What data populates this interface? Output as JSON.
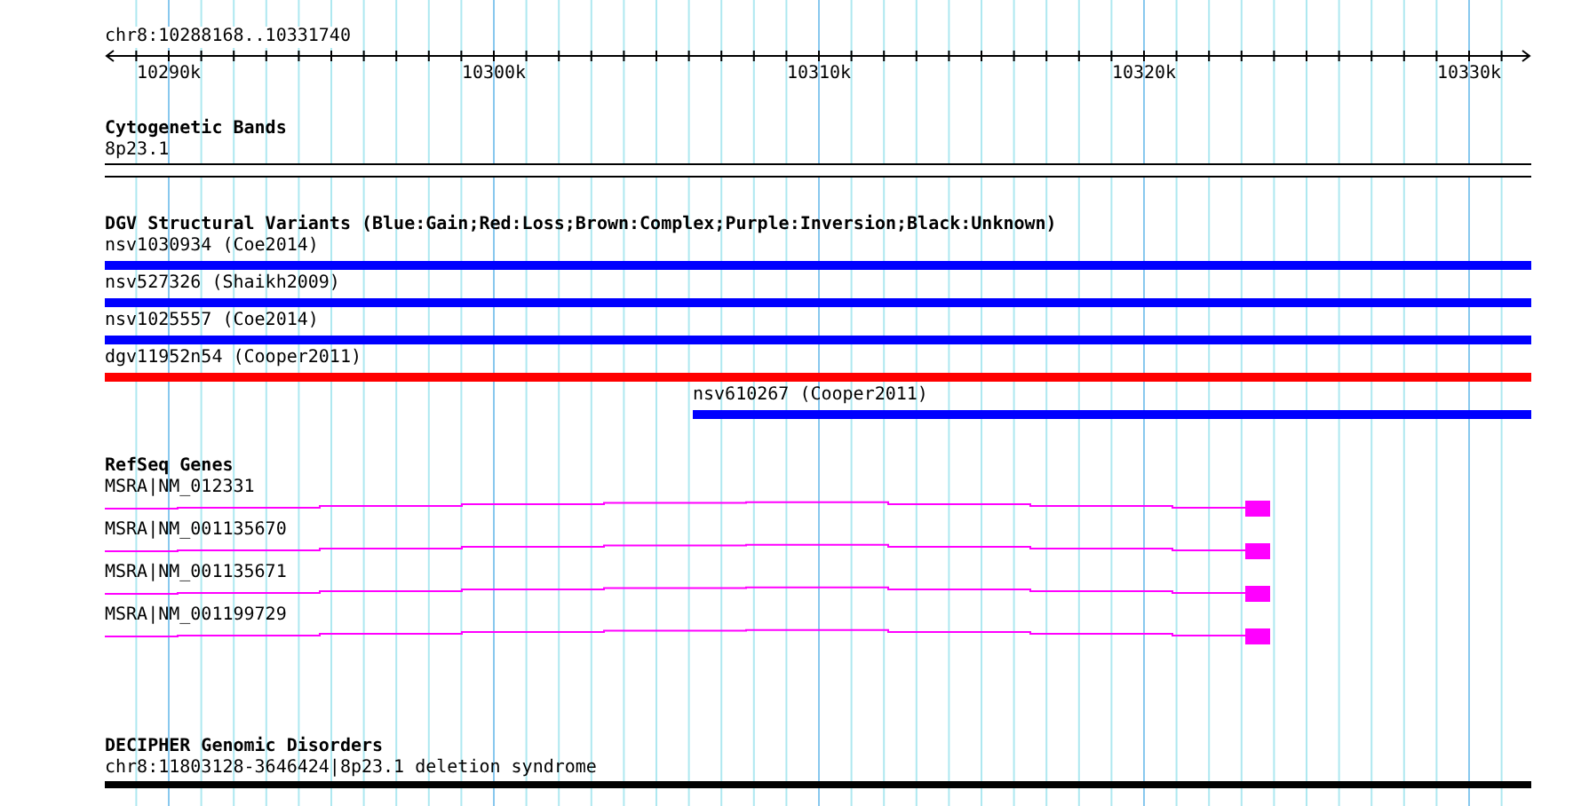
{
  "ruler": {
    "location": "chr8:10288168..10331740",
    "ticks": [
      "10290k",
      "10300k",
      "10310k",
      "10320k",
      "10330k"
    ]
  },
  "tracks": [
    {
      "kind": "bands",
      "title": "Cytogenetic Bands",
      "features": [
        {
          "label": "8p23.1"
        }
      ]
    },
    {
      "kind": "variants",
      "title": "DGV Structural Variants (Blue:Gain;Red:Loss;Brown:Complex;Purple:Inversion;Black:Unknown)",
      "features": [
        {
          "label": "nsv1030934 (Coe2014)",
          "color": "#0000ff"
        },
        {
          "label": "nsv527326 (Shaikh2009)",
          "color": "#0000ff"
        },
        {
          "label": "nsv1025557 (Coe2014)",
          "color": "#0000ff"
        },
        {
          "label": "dgv11952n54 (Cooper2011)",
          "color": "#ff0000"
        },
        {
          "label": "nsv610267 (Cooper2011)",
          "color": "#0000ff"
        }
      ]
    },
    {
      "kind": "genes",
      "title": "RefSeq Genes",
      "features": [
        {
          "label": "MSRA|NM_012331"
        },
        {
          "label": "MSRA|NM_001135670"
        },
        {
          "label": "MSRA|NM_001135671"
        },
        {
          "label": "MSRA|NM_001199729"
        }
      ]
    },
    {
      "kind": "disorders",
      "title": "DECIPHER Genomic Disorders",
      "features": [
        {
          "label": "chr8:11803128-3646424|8p23.1 deletion syndrome"
        }
      ]
    }
  ]
}
